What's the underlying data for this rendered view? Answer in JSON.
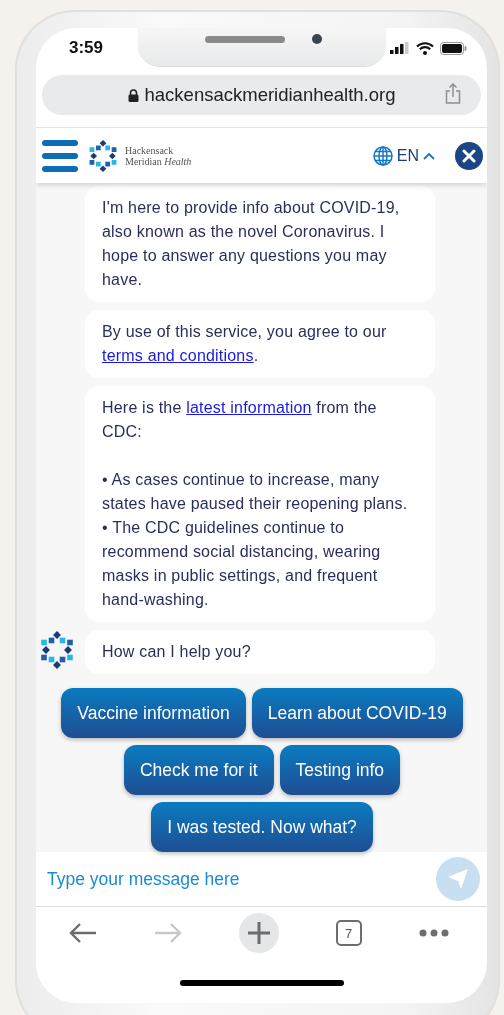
{
  "status_bar": {
    "time": "3:59"
  },
  "browser": {
    "url": "hackensackmeridianhealth.org"
  },
  "header": {
    "brand": [
      "Hackensack",
      "Meridian *Health*"
    ],
    "language": "EN",
    "language_menu_expanded": true
  },
  "messages": [
    {
      "avatar": false,
      "paragraphs": [
        [
          {
            "kind": "text",
            "text": "I'm here to provide info about COVID-19, also known as the novel Coronavirus. I hope to answer any questions you may have."
          }
        ]
      ]
    },
    {
      "avatar": false,
      "paragraphs": [
        [
          {
            "kind": "text",
            "text": "By use of this service, you agree to our "
          },
          {
            "kind": "link",
            "text": "terms and conditions"
          },
          {
            "kind": "text",
            "text": "."
          }
        ]
      ]
    },
    {
      "avatar": false,
      "paragraphs": [
        [
          {
            "kind": "text",
            "text": "Here is the "
          },
          {
            "kind": "link",
            "text": "latest information"
          },
          {
            "kind": "text",
            "text": " from the CDC:"
          }
        ],
        [
          {
            "kind": "text",
            "text": "• As cases continue to increase, many states have paused their reopening plans."
          }
        ],
        [
          {
            "kind": "text",
            "text": "• The CDC guidelines continue to recommend social distancing, wearing masks in public settings, and frequent hand-washing."
          }
        ]
      ]
    },
    {
      "avatar": true,
      "paragraphs": [
        [
          {
            "kind": "text",
            "text": "How can I help you?"
          }
        ]
      ]
    }
  ],
  "quick_replies": [
    [
      "Vaccine information",
      "Learn about COVID-19"
    ],
    [
      "Check me for it",
      "Testing info"
    ],
    [
      "I was tested. Now what?"
    ]
  ],
  "composer": {
    "placeholder": "Type your message here"
  },
  "toolbar": {
    "back_disabled": false,
    "forward_disabled": true,
    "tab_count": "7"
  }
}
